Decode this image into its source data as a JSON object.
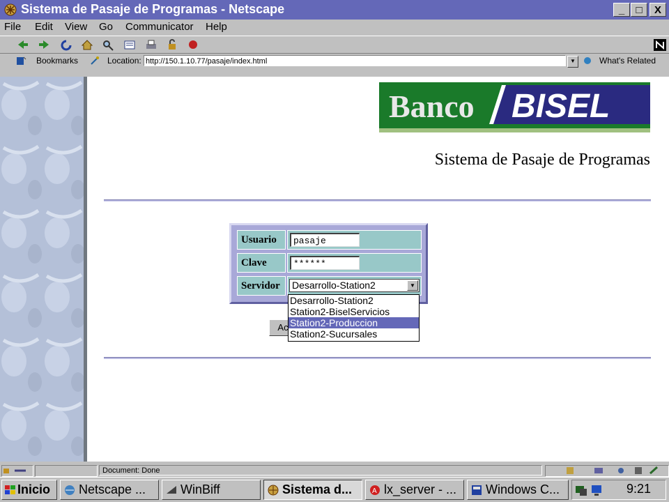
{
  "window": {
    "title": "Sistema de Pasaje de Programas - Netscape",
    "controls": [
      "_",
      "□",
      "X"
    ]
  },
  "menu": [
    "File",
    "Edit",
    "View",
    "Go",
    "Communicator",
    "Help"
  ],
  "location_bar": {
    "bookmarks_label": "Bookmarks",
    "location_label": "Location:",
    "url": "http://150.1.10.77/pasaje/index.html",
    "whats_related": "What's Related"
  },
  "page": {
    "logo_left": "Banco",
    "logo_right": "BISEL",
    "heading": "Sistema de Pasaje de Programas",
    "form": {
      "usuario_label": "Usuario",
      "usuario_value": "pasaje",
      "clave_label": "Clave",
      "clave_value": "******",
      "servidor_label": "Servidor",
      "servidor_value": "Desarrollo-Station2",
      "servidor_options": [
        "Desarrollo-Station2",
        "Station2-BiselServicios",
        "Station2-Produccion",
        "Station2-Sucursales"
      ],
      "highlighted_option": "Station2-Produccion",
      "accept_button": "Ac"
    }
  },
  "status": {
    "text": "Document: Done"
  },
  "taskbar": {
    "start": "Inicio",
    "tasks": [
      "Netscape ...",
      "WinBiff",
      "Sistema d...",
      "lx_server - ...",
      "Windows C..."
    ],
    "active_task": "Sistema d...",
    "clock": "9:21"
  },
  "colors": {
    "title_bar": "#6468b8",
    "form_cell": "#98c8c8",
    "form_frame": "#a8a8d8",
    "logo_bg": "#1a7a2a",
    "logo_accent": "#2a2a80"
  }
}
